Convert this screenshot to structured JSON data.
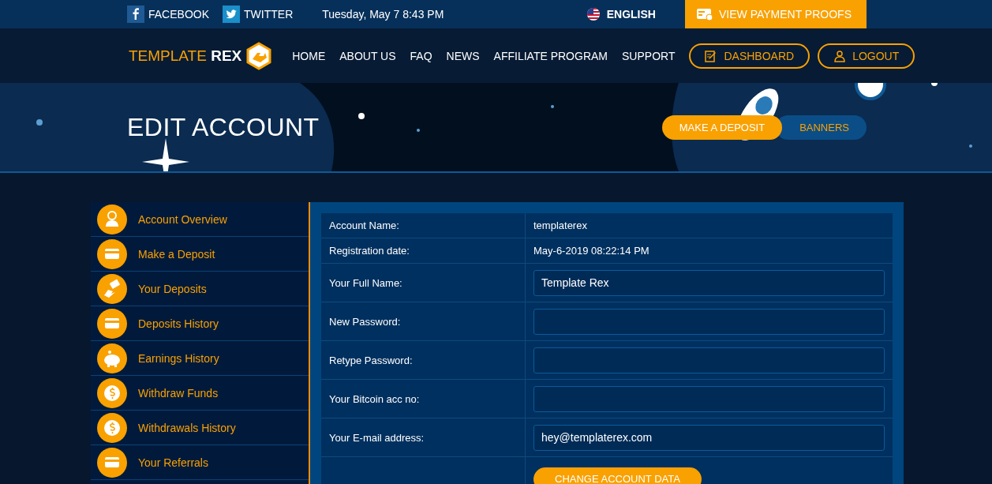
{
  "top_bar": {
    "social_links": [
      {
        "kind": "facebook",
        "label": "FACEBOOK"
      },
      {
        "kind": "twitter",
        "label": "TWITTER"
      }
    ],
    "datetime": "Tuesday, May 7 8:43 PM",
    "language": "ENGLISH",
    "payment_proofs_button": "VIEW PAYMENT PROOFS"
  },
  "nav": {
    "logo": {
      "first": "TEMPLATE",
      "second": "REX"
    },
    "menu": [
      "HOME",
      "ABOUT US",
      "FAQ",
      "NEWS",
      "AFFILIATE PROGRAM",
      "SUPPORT"
    ],
    "buttons": [
      {
        "kind": "dashboard",
        "label": "DASHBOARD"
      },
      {
        "kind": "logout",
        "label": "LOGOUT"
      }
    ]
  },
  "hero": {
    "title": "EDIT ACCOUNT",
    "buttons": [
      {
        "label": "MAKE A DEPOSIT",
        "primary": true
      },
      {
        "label": "BANNERS",
        "primary": false
      }
    ]
  },
  "sidebar": {
    "items": [
      {
        "kind": "user",
        "label": "Account Overview"
      },
      {
        "kind": "card",
        "label": "Make a Deposit"
      },
      {
        "kind": "hand",
        "label": "Your Deposits"
      },
      {
        "kind": "card",
        "label": "Deposits History"
      },
      {
        "kind": "piggy",
        "label": "Earnings History"
      },
      {
        "kind": "coin",
        "label": "Withdraw Funds"
      },
      {
        "kind": "coin",
        "label": "Withdrawals History"
      },
      {
        "kind": "card",
        "label": "Your Referrals"
      }
    ]
  },
  "form": {
    "rows": [
      {
        "kind": "text",
        "label": "Account Name:",
        "value": "templaterex"
      },
      {
        "kind": "text",
        "label": "Registration date:",
        "value": "May-6-2019 08:22:14 PM"
      },
      {
        "kind": "input",
        "label": "Your Full Name:",
        "value": "Template Rex"
      },
      {
        "kind": "input",
        "label": "New Password:"
      },
      {
        "kind": "input",
        "label": "Retype Password:"
      },
      {
        "kind": "input",
        "label": "Your Bitcoin acc no:"
      },
      {
        "kind": "input",
        "label": "Your E-mail address:",
        "value": "hey@templaterex.com"
      },
      {
        "kind": "submit",
        "button": "CHANGE ACCOUNT DATA"
      }
    ]
  }
}
